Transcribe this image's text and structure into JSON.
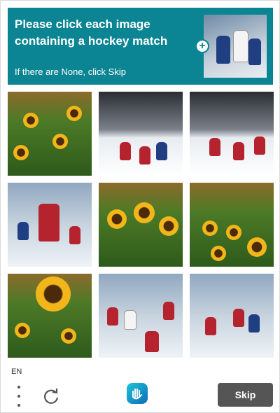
{
  "challenge": {
    "prompt": "Please click each image containing a hockey match",
    "subprompt": "If there are None, click Skip"
  },
  "colors": {
    "header_bg": "#0b8593",
    "skip_bg": "#555555"
  },
  "grid": [
    {
      "subject": "sunflowers"
    },
    {
      "subject": "hockey"
    },
    {
      "subject": "hockey"
    },
    {
      "subject": "hockey"
    },
    {
      "subject": "sunflowers"
    },
    {
      "subject": "sunflowers"
    },
    {
      "subject": "sunflowers"
    },
    {
      "subject": "hockey"
    },
    {
      "subject": "hockey"
    }
  ],
  "footer": {
    "language": "EN",
    "skip_label": "Skip"
  },
  "icons": {
    "example_add": "plus-icon",
    "menu": "more-vertical-icon",
    "refresh": "refresh-icon",
    "brand": "hand-logo-icon"
  }
}
